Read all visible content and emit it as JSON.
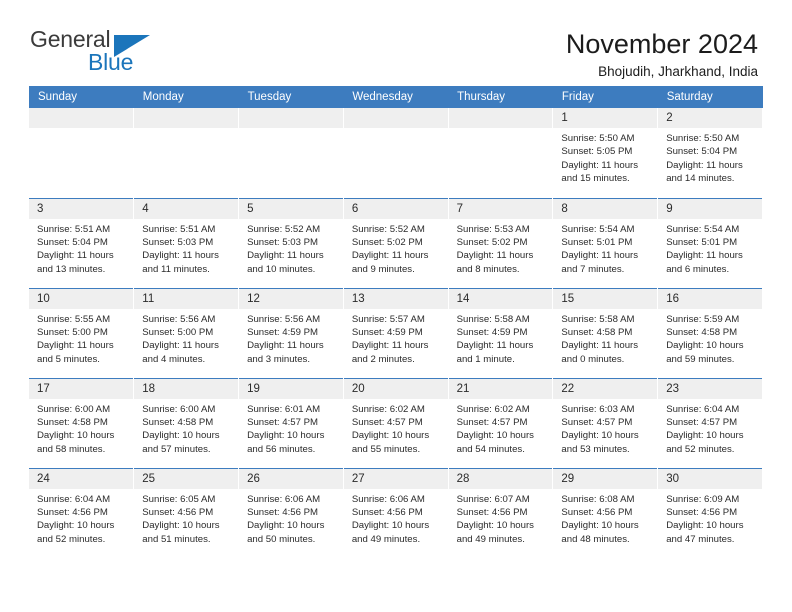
{
  "brand": {
    "name_top": "General",
    "name_bottom": "Blue",
    "triangle_icon": "blue-triangle-logo-mark",
    "color_primary": "#1b75bb",
    "color_text": "#3b3b3b"
  },
  "header": {
    "month_title": "November 2024",
    "location": "Bhojudih, Jharkhand, India"
  },
  "theme": {
    "header_blue": "#3d7cbf",
    "daynum_band": "#efefef",
    "cell_background": "#ffffff",
    "text": "#2b2b2b"
  },
  "calendar": {
    "weekday_headers": [
      "Sunday",
      "Monday",
      "Tuesday",
      "Wednesday",
      "Thursday",
      "Friday",
      "Saturday"
    ],
    "labels": {
      "sunrise_prefix": "Sunrise:",
      "sunset_prefix": "Sunset:",
      "daylight_prefix": "Daylight:"
    },
    "weeks": [
      [
        {
          "day": "",
          "empty": true
        },
        {
          "day": "",
          "empty": true
        },
        {
          "day": "",
          "empty": true
        },
        {
          "day": "",
          "empty": true
        },
        {
          "day": "",
          "empty": true
        },
        {
          "day": "1",
          "sunrise": "Sunrise: 5:50 AM",
          "sunset": "Sunset: 5:05 PM",
          "daylight": "Daylight: 11 hours and 15 minutes."
        },
        {
          "day": "2",
          "sunrise": "Sunrise: 5:50 AM",
          "sunset": "Sunset: 5:04 PM",
          "daylight": "Daylight: 11 hours and 14 minutes."
        }
      ],
      [
        {
          "day": "3",
          "sunrise": "Sunrise: 5:51 AM",
          "sunset": "Sunset: 5:04 PM",
          "daylight": "Daylight: 11 hours and 13 minutes."
        },
        {
          "day": "4",
          "sunrise": "Sunrise: 5:51 AM",
          "sunset": "Sunset: 5:03 PM",
          "daylight": "Daylight: 11 hours and 11 minutes."
        },
        {
          "day": "5",
          "sunrise": "Sunrise: 5:52 AM",
          "sunset": "Sunset: 5:03 PM",
          "daylight": "Daylight: 11 hours and 10 minutes."
        },
        {
          "day": "6",
          "sunrise": "Sunrise: 5:52 AM",
          "sunset": "Sunset: 5:02 PM",
          "daylight": "Daylight: 11 hours and 9 minutes."
        },
        {
          "day": "7",
          "sunrise": "Sunrise: 5:53 AM",
          "sunset": "Sunset: 5:02 PM",
          "daylight": "Daylight: 11 hours and 8 minutes."
        },
        {
          "day": "8",
          "sunrise": "Sunrise: 5:54 AM",
          "sunset": "Sunset: 5:01 PM",
          "daylight": "Daylight: 11 hours and 7 minutes."
        },
        {
          "day": "9",
          "sunrise": "Sunrise: 5:54 AM",
          "sunset": "Sunset: 5:01 PM",
          "daylight": "Daylight: 11 hours and 6 minutes."
        }
      ],
      [
        {
          "day": "10",
          "sunrise": "Sunrise: 5:55 AM",
          "sunset": "Sunset: 5:00 PM",
          "daylight": "Daylight: 11 hours and 5 minutes."
        },
        {
          "day": "11",
          "sunrise": "Sunrise: 5:56 AM",
          "sunset": "Sunset: 5:00 PM",
          "daylight": "Daylight: 11 hours and 4 minutes."
        },
        {
          "day": "12",
          "sunrise": "Sunrise: 5:56 AM",
          "sunset": "Sunset: 4:59 PM",
          "daylight": "Daylight: 11 hours and 3 minutes."
        },
        {
          "day": "13",
          "sunrise": "Sunrise: 5:57 AM",
          "sunset": "Sunset: 4:59 PM",
          "daylight": "Daylight: 11 hours and 2 minutes."
        },
        {
          "day": "14",
          "sunrise": "Sunrise: 5:58 AM",
          "sunset": "Sunset: 4:59 PM",
          "daylight": "Daylight: 11 hours and 1 minute."
        },
        {
          "day": "15",
          "sunrise": "Sunrise: 5:58 AM",
          "sunset": "Sunset: 4:58 PM",
          "daylight": "Daylight: 11 hours and 0 minutes."
        },
        {
          "day": "16",
          "sunrise": "Sunrise: 5:59 AM",
          "sunset": "Sunset: 4:58 PM",
          "daylight": "Daylight: 10 hours and 59 minutes."
        }
      ],
      [
        {
          "day": "17",
          "sunrise": "Sunrise: 6:00 AM",
          "sunset": "Sunset: 4:58 PM",
          "daylight": "Daylight: 10 hours and 58 minutes."
        },
        {
          "day": "18",
          "sunrise": "Sunrise: 6:00 AM",
          "sunset": "Sunset: 4:58 PM",
          "daylight": "Daylight: 10 hours and 57 minutes."
        },
        {
          "day": "19",
          "sunrise": "Sunrise: 6:01 AM",
          "sunset": "Sunset: 4:57 PM",
          "daylight": "Daylight: 10 hours and 56 minutes."
        },
        {
          "day": "20",
          "sunrise": "Sunrise: 6:02 AM",
          "sunset": "Sunset: 4:57 PM",
          "daylight": "Daylight: 10 hours and 55 minutes."
        },
        {
          "day": "21",
          "sunrise": "Sunrise: 6:02 AM",
          "sunset": "Sunset: 4:57 PM",
          "daylight": "Daylight: 10 hours and 54 minutes."
        },
        {
          "day": "22",
          "sunrise": "Sunrise: 6:03 AM",
          "sunset": "Sunset: 4:57 PM",
          "daylight": "Daylight: 10 hours and 53 minutes."
        },
        {
          "day": "23",
          "sunrise": "Sunrise: 6:04 AM",
          "sunset": "Sunset: 4:57 PM",
          "daylight": "Daylight: 10 hours and 52 minutes."
        }
      ],
      [
        {
          "day": "24",
          "sunrise": "Sunrise: 6:04 AM",
          "sunset": "Sunset: 4:56 PM",
          "daylight": "Daylight: 10 hours and 52 minutes."
        },
        {
          "day": "25",
          "sunrise": "Sunrise: 6:05 AM",
          "sunset": "Sunset: 4:56 PM",
          "daylight": "Daylight: 10 hours and 51 minutes."
        },
        {
          "day": "26",
          "sunrise": "Sunrise: 6:06 AM",
          "sunset": "Sunset: 4:56 PM",
          "daylight": "Daylight: 10 hours and 50 minutes."
        },
        {
          "day": "27",
          "sunrise": "Sunrise: 6:06 AM",
          "sunset": "Sunset: 4:56 PM",
          "daylight": "Daylight: 10 hours and 49 minutes."
        },
        {
          "day": "28",
          "sunrise": "Sunrise: 6:07 AM",
          "sunset": "Sunset: 4:56 PM",
          "daylight": "Daylight: 10 hours and 49 minutes."
        },
        {
          "day": "29",
          "sunrise": "Sunrise: 6:08 AM",
          "sunset": "Sunset: 4:56 PM",
          "daylight": "Daylight: 10 hours and 48 minutes."
        },
        {
          "day": "30",
          "sunrise": "Sunrise: 6:09 AM",
          "sunset": "Sunset: 4:56 PM",
          "daylight": "Daylight: 10 hours and 47 minutes."
        }
      ]
    ]
  }
}
